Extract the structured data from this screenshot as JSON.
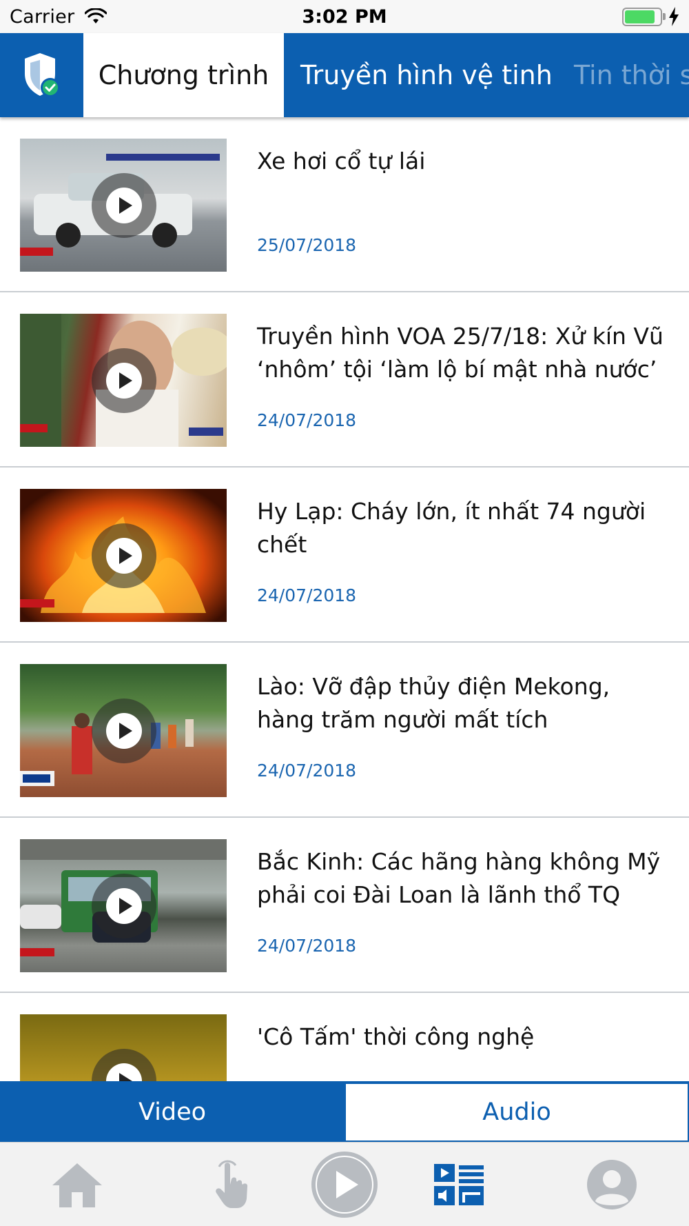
{
  "status_bar": {
    "carrier": "Carrier",
    "time": "3:02 PM",
    "battery_level": 0.85
  },
  "top_tabs": {
    "items": [
      {
        "label": "Chương trình",
        "active": true
      },
      {
        "label": "Truyền hình vệ tinh",
        "active": false
      },
      {
        "label": "Tin thời s",
        "active": false
      }
    ]
  },
  "videos": [
    {
      "title": "Xe hơi cổ tự lái",
      "date": "25/07/2018"
    },
    {
      "title": "Truyền hình VOA 25/7/18: Xử kín Vũ ‘nhôm’ tội ‘làm lộ bí mật nhà nước’",
      "date": "24/07/2018"
    },
    {
      "title": "Hy Lạp: Cháy lớn, ít nhất 74 người chết",
      "date": "24/07/2018"
    },
    {
      "title": "Lào: Vỡ đập thủy điện Mekong, hàng trăm người mất tích",
      "date": "24/07/2018"
    },
    {
      "title": "Bắc Kinh: Các hãng hàng không Mỹ phải coi Đài Loan là lãnh thổ TQ",
      "date": "24/07/2018"
    },
    {
      "title": "'Cô Tấm' thời công nghệ",
      "date": ""
    }
  ],
  "segment": {
    "video_label": "Video",
    "audio_label": "Audio",
    "selected": "Video"
  },
  "bottom_nav": {
    "items": [
      "home-icon",
      "touch-icon",
      "play-icon",
      "media-list-icon",
      "profile-icon"
    ],
    "active": "media-list-icon"
  },
  "colors": {
    "brand_blue": "#0c5fb0",
    "date_blue": "#1a65b0",
    "inactive_gray": "#b8bcc1"
  }
}
